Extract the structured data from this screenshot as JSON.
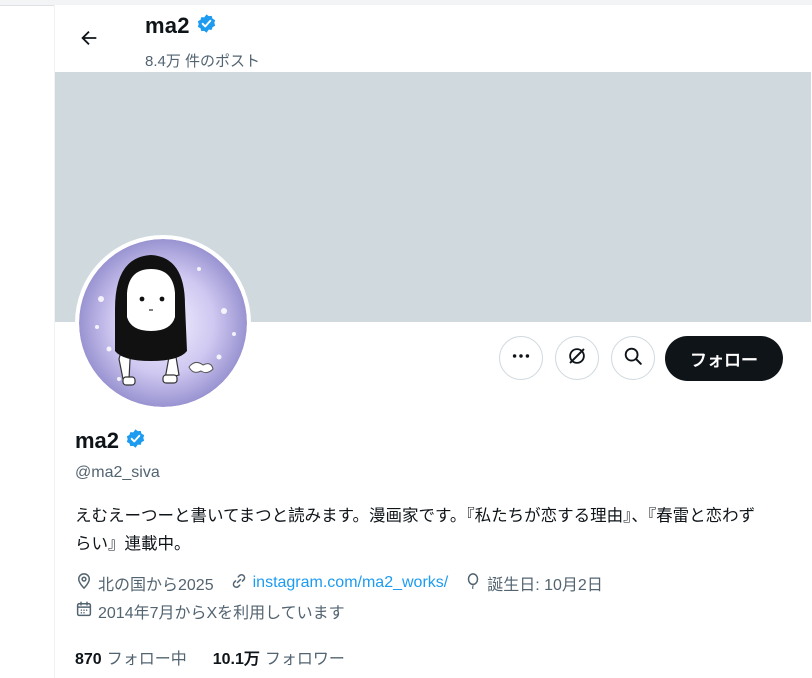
{
  "header": {
    "name": "ma2",
    "post_count": "8.4万 件のポスト"
  },
  "profile": {
    "name": "ma2",
    "handle": "@ma2_siva",
    "bio": "えむえーつーと書いてまつと読みます。漫画家です。『私たちが恋する理由』、『春雷と恋わずらい』連載中。",
    "location": "北の国から2025",
    "link": "instagram.com/ma2_works/",
    "birthday": "誕生日: 10月2日",
    "joined": "2014年7月からXを利用しています"
  },
  "actions": {
    "follow_label": "フォロー"
  },
  "stats": {
    "following_count": "870",
    "following_label": "フォロー中",
    "followers_count": "10.1万",
    "followers_label": "フォロワー"
  },
  "colors": {
    "verified": "#1d9bf0",
    "banner": "#cfd9de",
    "link": "#1d9bf0",
    "follow_button": "#0f1419"
  }
}
